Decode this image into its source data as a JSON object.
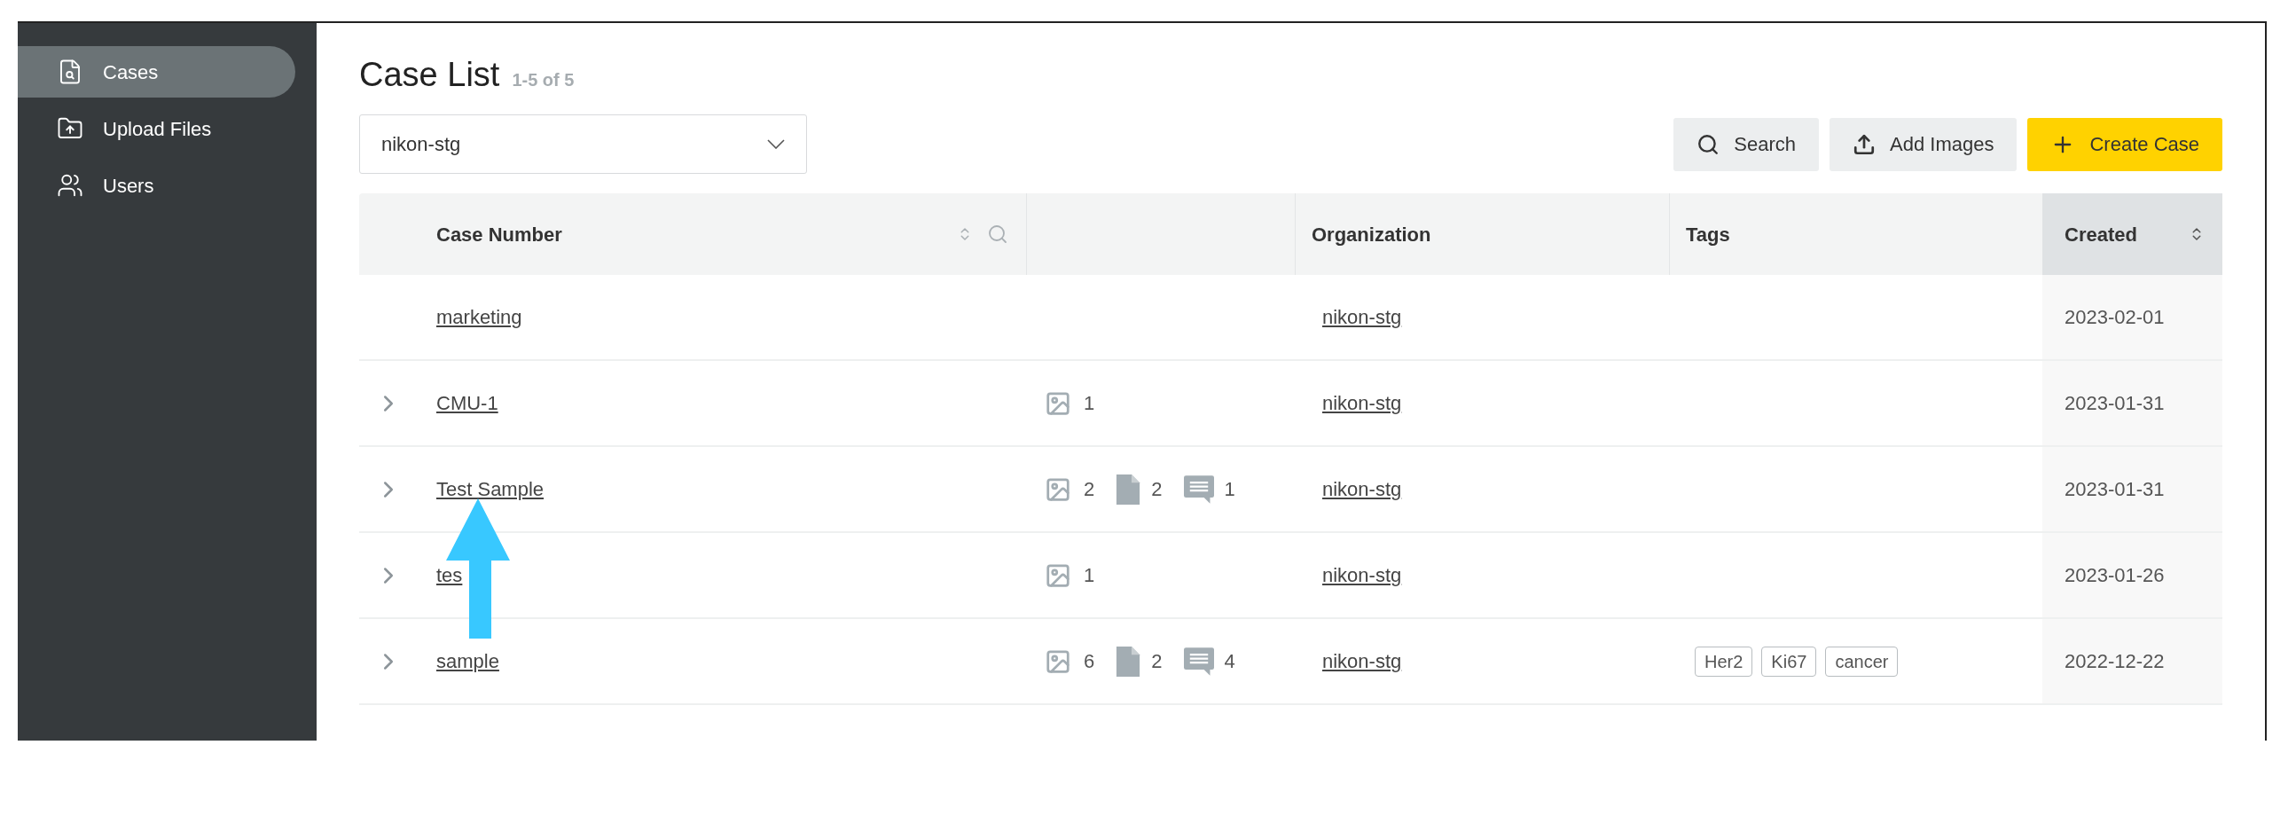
{
  "sidebar": {
    "items": [
      {
        "kind": "cases",
        "label": "Cases",
        "selected": true
      },
      {
        "kind": "upload",
        "label": "Upload Files",
        "selected": false
      },
      {
        "kind": "users",
        "label": "Users",
        "selected": false
      }
    ]
  },
  "header": {
    "title": "Case List",
    "range": "1-5 of 5"
  },
  "org_select": {
    "value": "nikon-stg"
  },
  "buttons": [
    {
      "kind": "search",
      "label": "Search"
    },
    {
      "kind": "upload",
      "label": "Add Images"
    },
    {
      "kind": "create",
      "label": "Create Case"
    }
  ],
  "table": {
    "columns": [
      {
        "label": "Case Number",
        "kind": "case"
      },
      {
        "kind": "counts"
      },
      {
        "label": "Organization",
        "kind": "org"
      },
      {
        "label": "Tags",
        "kind": "tags"
      },
      {
        "label": "Created",
        "kind": "created"
      }
    ],
    "rows": [
      {
        "expandable": false,
        "case": "marketing",
        "counts": [],
        "org": "nikon-stg",
        "tags": [],
        "created": "2023-02-01"
      },
      {
        "expandable": true,
        "case": "CMU-1",
        "counts": [
          {
            "kind": "image",
            "value": "1"
          }
        ],
        "org": "nikon-stg",
        "tags": [],
        "created": "2023-01-31"
      },
      {
        "expandable": true,
        "case": "Test Sample",
        "counts": [
          {
            "kind": "image",
            "value": "2"
          },
          {
            "kind": "file",
            "value": "2"
          },
          {
            "kind": "comment",
            "value": "1"
          }
        ],
        "org": "nikon-stg",
        "tags": [],
        "created": "2023-01-31"
      },
      {
        "expandable": true,
        "case": "tes",
        "counts": [
          {
            "kind": "image",
            "value": "1"
          }
        ],
        "org": "nikon-stg",
        "tags": [],
        "created": "2023-01-26"
      },
      {
        "expandable": true,
        "case": "sample",
        "counts": [
          {
            "kind": "image",
            "value": "6"
          },
          {
            "kind": "file",
            "value": "2"
          },
          {
            "kind": "comment",
            "value": "4"
          }
        ],
        "org": "nikon-stg",
        "tags": [
          "Her2",
          "Ki67",
          "cancer"
        ],
        "created": "2022-12-22"
      }
    ]
  }
}
